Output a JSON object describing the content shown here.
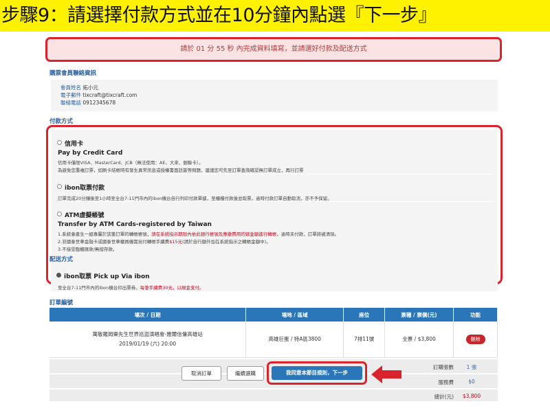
{
  "banner": {
    "text": "步驟9：請選擇付款方式並在10分鐘內點選『下一步』"
  },
  "countdown": {
    "text": "請於 01 分 55 秒 內完成資料填寫，並請選好付款及配送方式"
  },
  "member_section": {
    "title": "購票會員聯絡資訊",
    "name_label": "會員姓名",
    "name_value": "拓小元",
    "email_label": "電子郵件",
    "email_value": "tixcraft@tixcraft.com",
    "phone_label": "聯絡電話",
    "phone_value": "0912345678"
  },
  "payment_section": {
    "title": "付款方式",
    "options": [
      {
        "name": "信用卡",
        "en": "Pay by Credit Card",
        "desc1": "信用卡僅限VISA、MasterCard、JCB（無法使用：AE、大來、銀聯卡）。",
        "desc2": "為避免您重複訂票，如刷卡結帳時有發生異常訊息或授權書面話簽等問題，建議您可先至訂單查詢確認無訂單成立，再行訂票"
      },
      {
        "name": "ibon取票付款",
        "desc1": "訂單完成20分鐘後至1小時至全台7-11門市內的ibon機台自行列印付款單據，至櫃檯付款後並取票，逾時付款訂單自動取消，亦不予保留。"
      },
      {
        "name": "ATM虛擬帳號",
        "en": "Transfer by ATM Cards-registered by Taiwan",
        "desc1_a": "1.系統會產生一組專屬於該筆訂單的轉帳帳號，",
        "desc1_b": "請在系統指示期限內依此銀行帳號及應繳費用的總金額進行轉帳",
        "desc1_c": "，逾時未付款，訂單將被清除。",
        "desc2_a": "2.非國泰世華金融卡或國泰世華櫃員機需另付轉帳手續費",
        "desc2_b": "$15元",
        "desc2_c": "(請於自行額外加在系統指示之轉帳金額中)。",
        "desc3": "3.不接受臨櫃匯款/無摺存款。"
      }
    ]
  },
  "delivery_section": {
    "title": "配送方式",
    "option_name": "ibon取票 Pick up Via ibon",
    "desc_a": "至全台7-11門市內的ibon機台印出票券。",
    "desc_b": "每筆手續費30元，以現金支付。"
  },
  "order_section": {
    "title": "訂單編號",
    "headers": [
      "場次 / 日期",
      "場地 / 區域",
      "座位",
      "票種 / 票價(元)",
      "功能"
    ],
    "row": {
      "event": "萬敬羅姆樂先生世界巡迴演唱會-雅爾信傭高雄站",
      "date": "2019/01/19 (六) 20:00",
      "venue": "高雄巨蛋 / 特A區3800",
      "seat": "7排11號",
      "ticket": "全票 / $3,800",
      "action": "刪除"
    },
    "summary": [
      {
        "label": "訂購張數",
        "value": "1 張"
      },
      {
        "label": "服務費",
        "value": "$0"
      },
      {
        "label": "總計(元)",
        "value": "$3,800"
      }
    ]
  },
  "buttons": {
    "cancel": "取消訂單",
    "continue": "繼續選購",
    "next": "我同意本節目規則，下一步"
  },
  "colors": {
    "banner_bg": "#fff200",
    "highlight_border": "#d9232d",
    "table_header": "#2b76b9"
  }
}
